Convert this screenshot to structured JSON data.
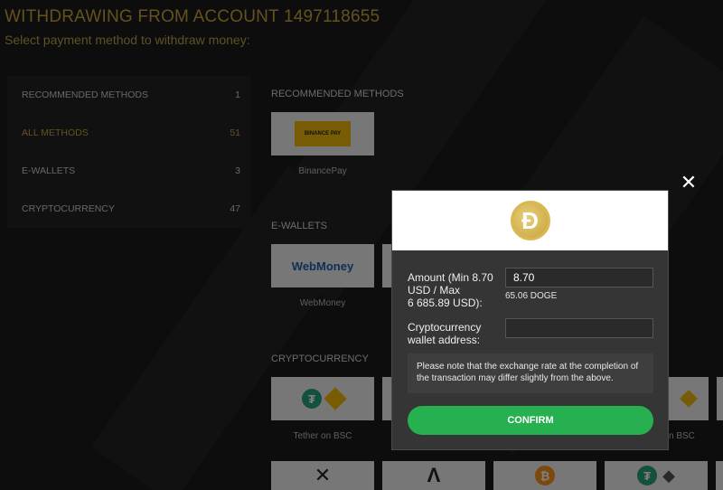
{
  "header": {
    "title": "WITHDRAWING FROM ACCOUNT 1497118655",
    "subtitle": "Select payment method to withdraw money:"
  },
  "sidebar": {
    "items": [
      {
        "label": "RECOMMENDED METHODS",
        "count": "1",
        "active": false
      },
      {
        "label": "ALL METHODS",
        "count": "51",
        "active": true
      },
      {
        "label": "E-WALLETS",
        "count": "3",
        "active": false
      },
      {
        "label": "CRYPTOCURRENCY",
        "count": "47",
        "active": false
      }
    ]
  },
  "sections": {
    "recommended": "RECOMMENDED METHODS",
    "ewallets": "E-WALLETS",
    "crypto": "CRYPTOCURRENCY"
  },
  "cards": {
    "binancepay_logo": "BINANCE PAY",
    "binancepay_label": "BinancePay",
    "webmoney_logo": "WebMoney",
    "webmoney_label": "WebMoney",
    "tether_bsc_label": "Tether on BSC",
    "partial_bsc_label": "n BSC"
  },
  "modal": {
    "coin_icon": "dogecoin-icon",
    "coin_glyph": "Ð",
    "amount_label_line1": "Amount (Min 8.70",
    "amount_label_line2": "USD / Max",
    "amount_label_line3": "6 685.89 USD):",
    "amount_value": "8.70",
    "conversion": "65.06 DOGE",
    "wallet_label_line1": "Cryptocurrency",
    "wallet_label_line2": "wallet address:",
    "wallet_value": "",
    "note": "Please note that the exchange rate at the completion of the transaction may differ slightly from the above.",
    "confirm_label": "CONFIRM",
    "close_glyph": "✕"
  },
  "colors": {
    "accent": "#c8a33a",
    "confirm": "#27b04f",
    "background": "#1b1b1b"
  }
}
